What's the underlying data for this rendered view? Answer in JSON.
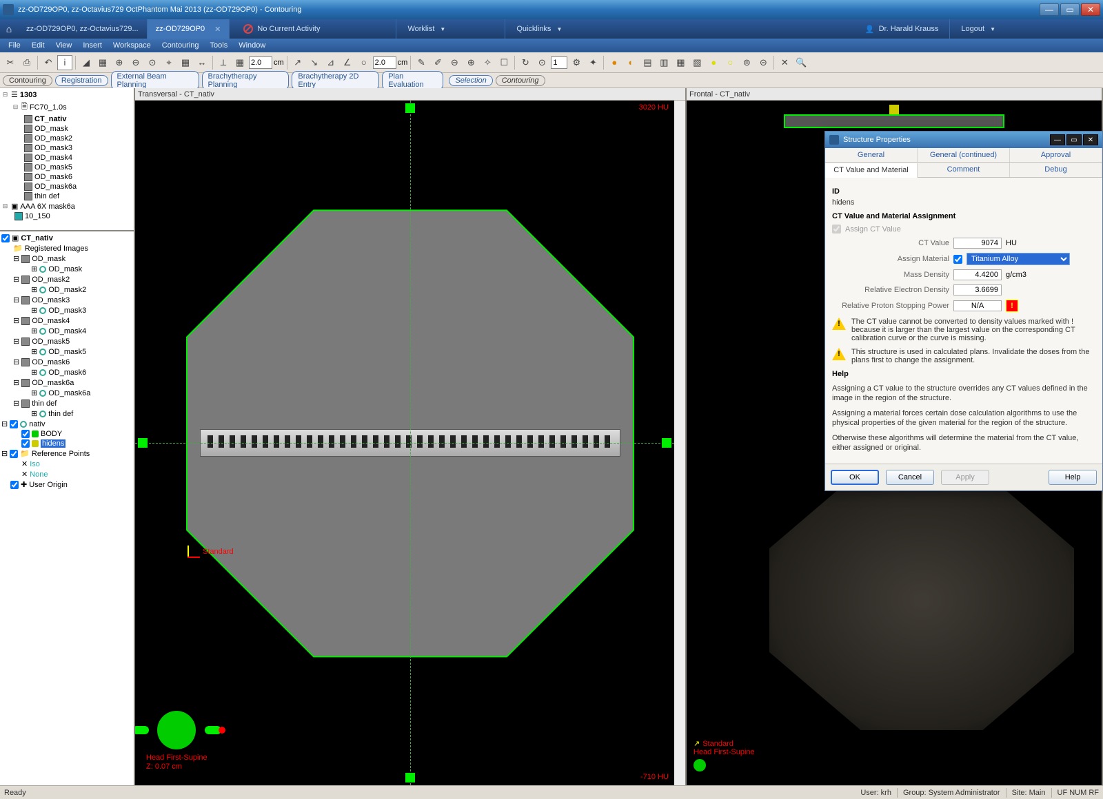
{
  "window": {
    "title": "zz-OD729OP0, zz-Octavius729 OctPhantom Mai 2013 (zz-OD729OP0) - Contouring"
  },
  "tabs": {
    "tab1": "zz-OD729OP0, zz-Octavius729...",
    "tab2": "zz-OD729OP0",
    "activity": "No Current Activity",
    "worklist": "Worklist",
    "quicklinks": "Quicklinks",
    "user": "Dr. Harald Krauss",
    "logout": "Logout"
  },
  "menu": {
    "file": "File",
    "edit": "Edit",
    "view": "View",
    "insert": "Insert",
    "workspace": "Workspace",
    "contouring": "Contouring",
    "tools": "Tools",
    "window": "Window"
  },
  "toolbar": {
    "val1": "2.0",
    "unit1": "cm",
    "val2": "2.0",
    "unit2": "cm",
    "val3": "1"
  },
  "subtabs": {
    "contouring": "Contouring",
    "registration": "Registration",
    "ebp": "External Beam Planning",
    "brachy": "Brachytherapy Planning",
    "brachy2d": "Brachytherapy 2D Entry",
    "planeval": "Plan Evaluation",
    "selection": "Selection",
    "contouring2": "Contouring"
  },
  "tree1": {
    "root": "1303",
    "series": "FC70_1.0s",
    "ct": "CT_nativ",
    "masks": [
      "OD_mask",
      "OD_mask2",
      "OD_mask3",
      "OD_mask4",
      "OD_mask5",
      "OD_mask6",
      "OD_mask6a",
      "thin def"
    ],
    "plan": "AAA 6X mask6a",
    "planrow": "10_150"
  },
  "tree2": {
    "ct": "CT_nativ",
    "reg": "Registered Images",
    "masks": [
      "OD_mask",
      "OD_mask2",
      "OD_mask3",
      "OD_mask4",
      "OD_mask5",
      "OD_mask6",
      "OD_mask6a",
      "thin def"
    ],
    "nativ": "nativ",
    "body": "BODY",
    "hidens": "hidens",
    "refpts": "Reference Points",
    "iso": "Iso",
    "none": "None",
    "uo": "User Origin"
  },
  "views": {
    "transversal": "Transversal - CT_nativ",
    "frontal": "Frontal - CT_nativ",
    "hu_top": "3020 HU",
    "hu_bot": "-710 HU",
    "standard": "Standard",
    "orientation": "Head First-Supine",
    "z": "Z: 0.07 cm"
  },
  "dialog": {
    "title": "Structure Properties",
    "tabs": {
      "general": "General",
      "general2": "General (continued)",
      "approval": "Approval",
      "ctval": "CT Value and Material",
      "comment": "Comment",
      "debug": "Debug"
    },
    "id_label": "ID",
    "id_value": "hidens",
    "section": "CT Value and Material Assignment",
    "assign_ct": "Assign CT Value",
    "ctvalue_label": "CT Value",
    "ctvalue": "9074",
    "hu": "HU",
    "assign_mat": "Assign Material",
    "material": "Titanium Alloy",
    "massdensity_label": "Mass Density",
    "massdensity": "4.4200",
    "gcm3": "g/cm3",
    "red_label": "Relative Electron Density",
    "red": "3.6699",
    "rpsp_label": "Relative Proton Stopping Power",
    "rpsp": "N/A",
    "warn1": "The CT value cannot be converted to density values marked with ! because it is larger than the largest value on the corresponding CT calibration curve or the curve is missing.",
    "warn2": "This structure is used in calculated plans. Invalidate the doses from the plans first to change the assignment.",
    "help_title": "Help",
    "help1": "Assigning a CT value to the structure overrides any CT values defined in the image in the region of the structure.",
    "help2": "Assigning a material forces certain dose calculation algorithms to use the physical properties of the given material for the region of the structure.",
    "help3": "Otherwise these algorithms will determine the material from the CT value, either assigned or original.",
    "ok": "OK",
    "cancel": "Cancel",
    "apply": "Apply",
    "helpbtn": "Help"
  },
  "status": {
    "ready": "Ready",
    "user": "User:  krh",
    "group": "Group: System Administrator",
    "site": "Site: Main",
    "caps": "UF  NUM  RF"
  }
}
